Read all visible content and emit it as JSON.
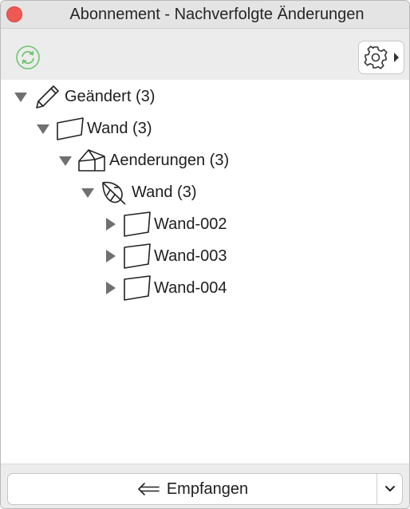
{
  "window": {
    "title": "Abonnement - Nachverfolgte Änderungen"
  },
  "toolbar": {
    "refresh_icon": "refresh-icon",
    "settings_icon": "gear-icon",
    "accent_color": "#4caf50"
  },
  "tree": {
    "nodes": [
      {
        "label": "Geändert (3)",
        "icon": "pencil-icon",
        "expanded": true
      },
      {
        "label": "Wand (3)",
        "icon": "wall-icon",
        "expanded": true
      },
      {
        "label": "Aenderungen (3)",
        "icon": "building-icon",
        "expanded": true
      },
      {
        "label": "Wand (3)",
        "icon": "leaf-icon",
        "expanded": true
      },
      {
        "label": "Wand-002",
        "icon": "wall-icon",
        "expanded": false
      },
      {
        "label": "Wand-003",
        "icon": "wall-icon",
        "expanded": false
      },
      {
        "label": "Wand-004",
        "icon": "wall-icon",
        "expanded": false
      }
    ]
  },
  "footer": {
    "receive_label": "Empfangen",
    "receive_icon": "arrow-left-icon",
    "dropdown_icon": "chevron-down-icon"
  }
}
